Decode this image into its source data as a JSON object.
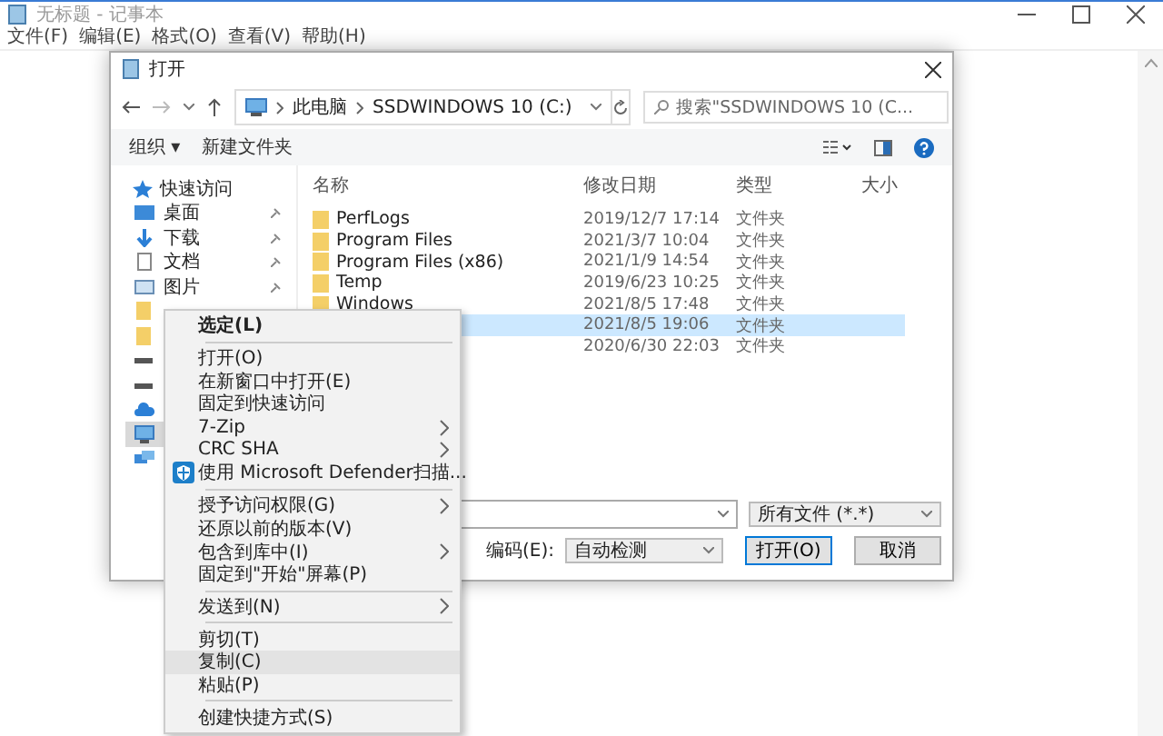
{
  "notepad": {
    "title": "无标题 - 记事本",
    "menu": [
      "文件(F)",
      "编辑(E)",
      "格式(O)",
      "查看(V)",
      "帮助(H)"
    ]
  },
  "dialog": {
    "title": "打开",
    "breadcrumb": [
      "此电脑",
      "SSDWINDOWS 10 (C:)"
    ],
    "search": {
      "placeholder": "搜索\"SSDWINDOWS 10 (C..."
    },
    "toolbar": [
      "组织 ▾",
      "新建文件夹"
    ],
    "quick_access": {
      "label": "快速访问",
      "items": [
        {
          "kind": "desktop",
          "label": "桌面",
          "pinned": true
        },
        {
          "kind": "download",
          "label": "下载",
          "pinned": true
        },
        {
          "kind": "document",
          "label": "文档",
          "pinned": true
        },
        {
          "kind": "picture",
          "label": "图片",
          "pinned": true
        }
      ]
    },
    "locations": [
      {
        "kind": "folder",
        "selected": false
      },
      {
        "kind": "folder",
        "selected": false
      },
      {
        "kind": "drive",
        "selected": false
      },
      {
        "kind": "drive",
        "selected": false
      },
      {
        "kind": "cloud",
        "selected": false
      },
      {
        "kind": "pc",
        "selected": true
      },
      {
        "kind": "network",
        "selected": false
      }
    ],
    "columns": [
      "名称",
      "修改日期",
      "类型",
      "大小"
    ],
    "rows": [
      {
        "name": "PerfLogs",
        "date": "2019/12/7 17:14",
        "type": "文件夹",
        "selected": false
      },
      {
        "name": "Program Files",
        "date": "2021/3/7 10:04",
        "type": "文件夹",
        "selected": false
      },
      {
        "name": "Program Files (x86)",
        "date": "2021/1/9 14:54",
        "type": "文件夹",
        "selected": false
      },
      {
        "name": "Temp",
        "date": "2019/6/23 10:25",
        "type": "文件夹",
        "selected": false
      },
      {
        "name": "Windows",
        "date": "2021/8/5 17:48",
        "type": "文件夹",
        "selected": false
      },
      {
        "date": "2021/8/5 19:06",
        "type": "文件夹",
        "selected": true
      },
      {
        "date": "2020/6/30 22:03",
        "type": "文件夹",
        "selected": false
      }
    ],
    "file_type": "所有文件 (*.*)",
    "encoding_label": "编码(E):",
    "encoding": "自动检测",
    "buttons": [
      "打开(O)",
      "取消"
    ]
  },
  "context_menu": [
    [
      {
        "kind": "plain",
        "label": "选定(L)",
        "bold": true,
        "highlighted": false
      }
    ],
    [
      {
        "kind": "plain",
        "label": "打开(O)",
        "bold": false,
        "highlighted": false
      },
      {
        "kind": "plain",
        "label": "在新窗口中打开(E)",
        "bold": false,
        "highlighted": false
      },
      {
        "kind": "plain",
        "label": "固定到快速访问",
        "bold": false,
        "highlighted": false
      },
      {
        "kind": "submenu",
        "label": "7-Zip",
        "bold": false,
        "highlighted": false
      },
      {
        "kind": "submenu",
        "label": "CRC SHA",
        "bold": false,
        "highlighted": false
      },
      {
        "kind": "icon",
        "label": "使用 Microsoft Defender扫描...",
        "bold": false,
        "highlighted": false
      }
    ],
    [
      {
        "kind": "submenu",
        "label": "授予访问权限(G)",
        "bold": false,
        "highlighted": false
      },
      {
        "kind": "plain",
        "label": "还原以前的版本(V)",
        "bold": false,
        "highlighted": false
      },
      {
        "kind": "submenu",
        "label": "包含到库中(I)",
        "bold": false,
        "highlighted": false
      },
      {
        "kind": "plain",
        "label": "固定到\"开始\"屏幕(P)",
        "bold": false,
        "highlighted": false
      }
    ],
    [
      {
        "kind": "submenu",
        "label": "发送到(N)",
        "bold": false,
        "highlighted": false
      }
    ],
    [
      {
        "kind": "plain",
        "label": "剪切(T)",
        "bold": false,
        "highlighted": false
      },
      {
        "kind": "plain",
        "label": "复制(C)",
        "bold": false,
        "highlighted": true
      },
      {
        "kind": "plain",
        "label": "粘贴(P)",
        "bold": false,
        "highlighted": false
      }
    ],
    [
      {
        "kind": "plain",
        "label": "创建快捷方式(S)",
        "bold": false,
        "highlighted": false
      }
    ]
  ]
}
